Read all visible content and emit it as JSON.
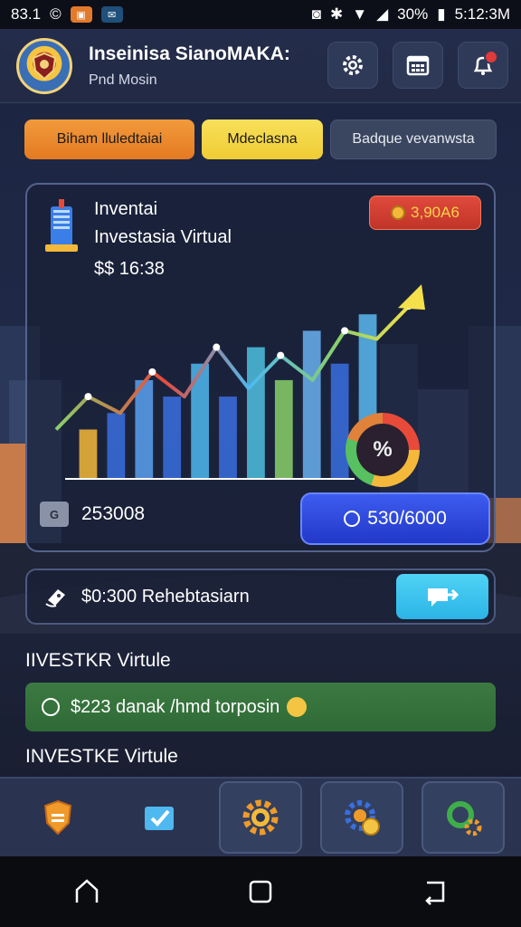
{
  "status_bar": {
    "time": "83.1",
    "battery": "30%",
    "clock": "5:12:3M"
  },
  "header": {
    "title": "Inseinisa SianoMAKA:",
    "subtitle": "Pnd Mosin"
  },
  "tabs": [
    {
      "label": "Biham lluledtaiai"
    },
    {
      "label": "Mdeclasna"
    },
    {
      "label": "Badque vevanwsta"
    }
  ],
  "card": {
    "title": "Inventai",
    "subtitle": "Investasia Virtual",
    "value": "$$ 16:38",
    "badge": "3,90A6",
    "gauge_symbol": "%",
    "footer_icon": "G",
    "footer_value": "253008",
    "balance_button": "530/6000"
  },
  "action": {
    "label": "$0:300 Rehebtasiarn"
  },
  "sections": {
    "first": "IIVESTKR Virtule",
    "promo": "$223 danak /hmd torposin",
    "second": "INVESTKE Virtule"
  },
  "chart_data": {
    "type": "bar",
    "values": [
      3,
      4,
      6,
      5,
      7,
      5,
      8,
      6,
      9,
      7,
      10
    ],
    "line": [
      3,
      5,
      4,
      6.5,
      5,
      8,
      5.5,
      7.5,
      6,
      9,
      8.5,
      10.5
    ]
  },
  "colors": {
    "accent_orange": "#e47a22",
    "accent_yellow": "#f0cc34",
    "accent_blue": "#2238c8",
    "promo_green": "#2f6a36"
  }
}
